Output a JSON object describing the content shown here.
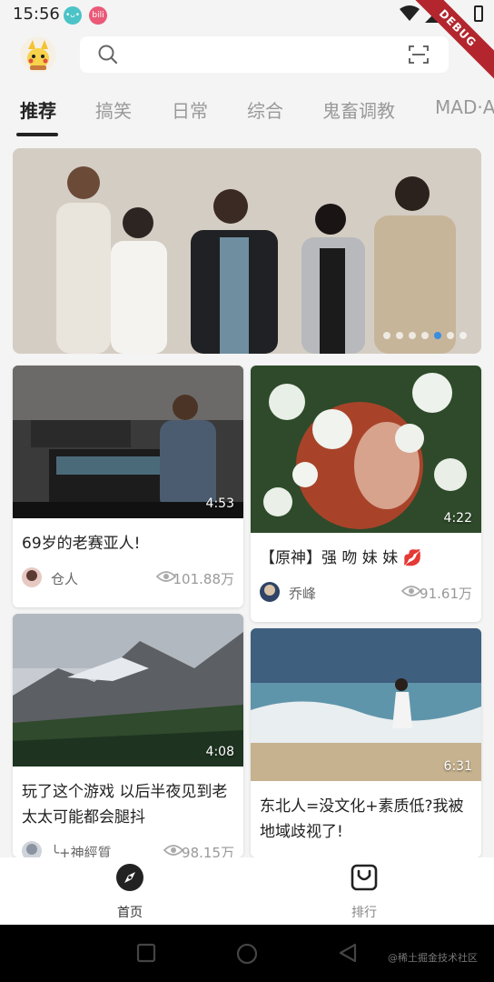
{
  "status_bar": {
    "time": "15:56",
    "debug_label": "DEBUG"
  },
  "search": {
    "placeholder": ""
  },
  "tabs": [
    {
      "label": "推荐",
      "active": true
    },
    {
      "label": "搞笑",
      "active": false
    },
    {
      "label": "日常",
      "active": false
    },
    {
      "label": "综合",
      "active": false
    },
    {
      "label": "鬼畜调教",
      "active": false
    },
    {
      "label": "MAD·A",
      "active": false
    }
  ],
  "banner": {
    "dot_count": 7,
    "active_dot": 4
  },
  "cards": [
    {
      "title": "69岁的老赛亚人!",
      "duration": "4:53",
      "author": "仓人",
      "views": "101.88万"
    },
    {
      "title": "【原神】强 吻 妹 妹 💋",
      "duration": "4:22",
      "author": "乔峰",
      "views": "91.61万"
    },
    {
      "title": "玩了这个游戏 以后半夜见到老太太可能都会腿抖",
      "duration": "4:08",
      "author": "╰+神經質",
      "views": "98.15万"
    },
    {
      "title": "东北人=没文化+素质低?我被地域歧视了!",
      "duration": "6:31",
      "author": "",
      "views": ""
    }
  ],
  "bottom_nav": {
    "home_label": "首页",
    "rank_label": "排行"
  },
  "watermark": "@稀土掘金技术社区",
  "colors": {
    "accent": "#3b8de0",
    "debug": "#b3262e"
  }
}
